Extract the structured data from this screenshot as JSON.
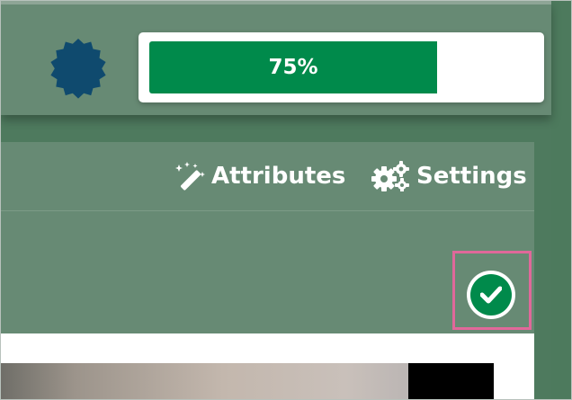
{
  "header": {
    "badge_icon": "badge-icon",
    "progress": {
      "label": "75%",
      "value": 0.75,
      "fill_color": "#008a4b"
    }
  },
  "tabs": [
    {
      "label": "Attributes",
      "icon": "magic-wand-icon"
    },
    {
      "label": "Settings",
      "icon": "gears-icon"
    }
  ],
  "actions": {
    "confirm_icon": "check-circle-icon",
    "confirm_color": "#008a4b",
    "highlight_color": "#e0689a"
  },
  "colors": {
    "panel": "#678a74",
    "badge": "#0f4a6e"
  }
}
